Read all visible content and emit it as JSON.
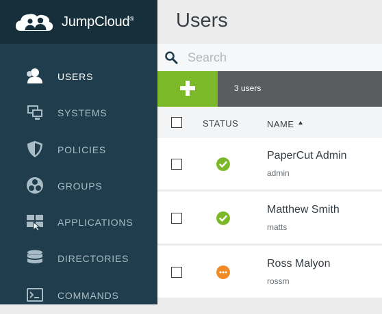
{
  "brand": {
    "name": "JumpCloud",
    "symbol": "®"
  },
  "colors": {
    "sidebar": "#1f3d4c",
    "sidebar_header": "#162f3b",
    "accent_green": "#7cb928",
    "action_bar": "#595d60",
    "status_active": "#7cb928",
    "status_pending": "#f08a24"
  },
  "nav": {
    "items": [
      {
        "label": "USERS",
        "icon": "users-icon",
        "active": true
      },
      {
        "label": "SYSTEMS",
        "icon": "systems-icon",
        "active": false
      },
      {
        "label": "POLICIES",
        "icon": "shield-icon",
        "active": false
      },
      {
        "label": "GROUPS",
        "icon": "groups-icon",
        "active": false
      },
      {
        "label": "APPLICATIONS",
        "icon": "applications-icon",
        "active": false
      },
      {
        "label": "DIRECTORIES",
        "icon": "database-icon",
        "active": false
      },
      {
        "label": "COMMANDS",
        "icon": "terminal-icon",
        "active": false
      }
    ]
  },
  "page": {
    "title": "Users"
  },
  "search": {
    "placeholder": "Search"
  },
  "toolbar": {
    "add_icon": "plus-icon",
    "count_label": "3 users"
  },
  "table": {
    "headers": {
      "status": "STATUS",
      "name": "NAME"
    },
    "sort": {
      "column": "name",
      "direction": "ascending"
    },
    "rows": [
      {
        "name": "PaperCut Admin",
        "username": "admin",
        "status": "active",
        "status_icon": "check-icon"
      },
      {
        "name": "Matthew Smith",
        "username": "matts",
        "status": "active",
        "status_icon": "check-icon"
      },
      {
        "name": "Ross Malyon",
        "username": "rossm",
        "status": "pending",
        "status_icon": "ellipsis-icon"
      }
    ]
  }
}
